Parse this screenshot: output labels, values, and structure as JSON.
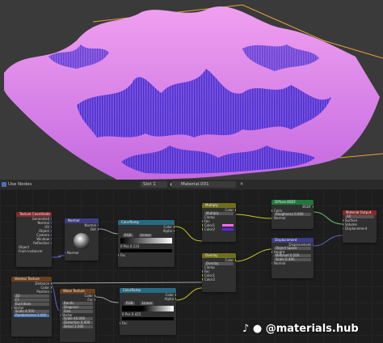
{
  "header": {
    "use_nodes_label": "Use Nodes",
    "slot_label": "Slot 1",
    "material_name": "Material.001"
  },
  "nodes": {
    "texcoord": {
      "title": "Texture Coordinate",
      "outputs": [
        "Generated",
        "Normal",
        "UV",
        "Object",
        "Camera",
        "Window",
        "Reflection"
      ],
      "object_label": "Object",
      "from_instancer": "From Instancer"
    },
    "normal": {
      "title": "Normal",
      "outputs": [
        "Normal",
        "Dot"
      ],
      "input": "Normal"
    },
    "colorramp1": {
      "title": "ColorRamp",
      "outputs": [
        "Color",
        "Alpha"
      ],
      "mode": "RGB",
      "interp": "Linear",
      "pos_value": "0",
      "pos_label": "Pos",
      "pos_num": "0.133",
      "input": "Fac"
    },
    "multiply": {
      "title": "Multiply",
      "output": "Color",
      "blend": "Multiply",
      "clamp": "Clamp",
      "inputs": [
        "Fac",
        "Color1",
        "Color2"
      ]
    },
    "overlay": {
      "title": "Overlay",
      "output": "Color",
      "blend": "Overlay",
      "clamp": "Clamp",
      "inputs": [
        "Fac",
        "Color1",
        "Color2"
      ]
    },
    "diffuse": {
      "title": "Diffuse BSDF",
      "output": "BSDF",
      "roughness_label": "Roughness",
      "roughness_value": "0.000",
      "normal": "Normal",
      "color": "Color"
    },
    "displacement": {
      "title": "Displacement",
      "output": "Displacement",
      "space": "Object Space",
      "inputs": [
        "Height"
      ],
      "midlevel_label": "Midlevel",
      "midlevel_value": "0.500",
      "scale_label": "Scale",
      "scale_value": "0.490",
      "normal": "Normal"
    },
    "output": {
      "title": "Material Output",
      "target": "All",
      "inputs": [
        "Surface",
        "Volume",
        "Displacement"
      ]
    },
    "gradient": {
      "title": "Gradient Texture",
      "outputs": [
        "Color",
        "Fac"
      ],
      "type": "Linear",
      "input": "Vector"
    },
    "voronoi": {
      "title": "Voronoi Texture",
      "outputs": [
        "Distance",
        "Color",
        "Position"
      ],
      "dims": "3D",
      "feature": "F1",
      "metric": "Euclidean",
      "vector": "Vector",
      "scale_label": "Scale",
      "scale_value": "4.500",
      "rand_label": "Randomness",
      "rand_value": "1.000"
    },
    "wave": {
      "title": "Wave Texture",
      "outputs": [
        "Color",
        "Fac"
      ],
      "type": "Bands",
      "dir": "Diagonal",
      "profile": "Sine",
      "vector": "Vector",
      "scale_label": "Scale",
      "scale_value": "40.000",
      "dist_label": "Distortion",
      "dist_value": "0.000",
      "detail_label": "Detail",
      "detail_value": "2.000"
    },
    "colorramp2": {
      "title": "ColorRamp",
      "outputs": [
        "Color",
        "Alpha"
      ],
      "mode": "RGB",
      "interp": "Linear",
      "pos_value": "0",
      "pos_label": "Pos",
      "pos_num": "0.425",
      "input": "Fac"
    }
  },
  "watermark": "@materials.hub",
  "colors": {
    "terrain_light": "#e48ae6",
    "terrain_dark": "#4a3bd6",
    "bounds": "#e8a23c",
    "multiply_swatch": "#ff66ff",
    "overlay_swatch": "#5b24e8"
  }
}
